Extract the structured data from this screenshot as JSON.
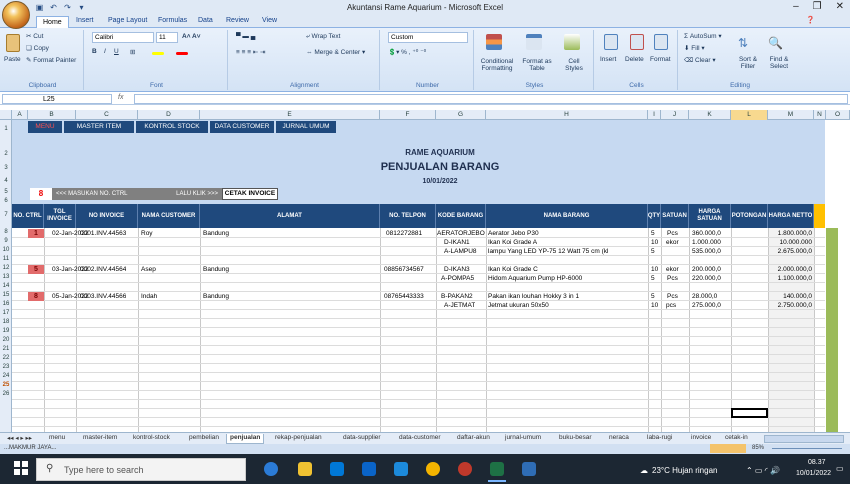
{
  "window": {
    "title": "Akuntansi Rame Aquarium - Microsoft Excel"
  },
  "ribbon_tabs": [
    "Home",
    "Insert",
    "Page Layout",
    "Formulas",
    "Data",
    "Review",
    "View"
  ],
  "ribbon": {
    "clipboard": {
      "paste": "Paste",
      "cut": "Cut",
      "copy": "Copy",
      "format_painter": "Format Painter",
      "label": "Clipboard"
    },
    "font": {
      "name": "Calibri",
      "size": "11",
      "label": "Font"
    },
    "alignment": {
      "wrap": "Wrap Text",
      "merge": "Merge & Center",
      "label": "Alignment"
    },
    "number": {
      "format": "Custom",
      "label": "Number"
    },
    "styles": {
      "conditional": "Conditional Formatting",
      "format_table": "Format as Table",
      "cell_styles": "Cell Styles",
      "label": "Styles"
    },
    "cells": {
      "insert": "Insert",
      "delete": "Delete",
      "format": "Format",
      "label": "Cells"
    },
    "editing": {
      "autosum": "AutoSum",
      "fill": "Fill",
      "clear": "Clear",
      "sort": "Sort & Filter",
      "find": "Find & Select",
      "label": "Editing"
    }
  },
  "formula_bar": {
    "cell_ref": "L25",
    "fx": "fx"
  },
  "columns": [
    "A",
    "B",
    "C",
    "D",
    "E",
    "F",
    "G",
    "H",
    "I",
    "J",
    "K",
    "L",
    "M",
    "N",
    "O"
  ],
  "rows": [
    "1",
    "2",
    "3",
    "4",
    "5",
    "6",
    "7",
    "8",
    "9",
    "10",
    "11",
    "12",
    "13",
    "14",
    "15",
    "16",
    "17",
    "18",
    "19",
    "20",
    "21",
    "22",
    "23",
    "24",
    "25",
    "26"
  ],
  "menu_buttons": [
    "MENU",
    "MASTER ITEM",
    "KONTROL STOCK",
    "DATA CUSTOMER",
    "JURNAL UMUM"
  ],
  "header": {
    "company": "RAME AQUARIUM",
    "title": "PENJUALAN BARANG",
    "date": "10/01/2022"
  },
  "ctrl": {
    "value": "8",
    "prompt": "<<< MASUKAN NO. CTRL",
    "next": "LALU KLIK >>>",
    "button": "CETAK INVOICE"
  },
  "table_headers": [
    "NO. CTRL",
    "TGL INVOICE",
    "NO INVOICE",
    "NAMA CUSTOMER",
    "ALAMAT",
    "NO. TELPON",
    "KODE BARANG",
    "NAMA BARANG",
    "QTY",
    "SATUAN",
    "HARGA SATUAN",
    "POTONGAN",
    "HARGA NETTO"
  ],
  "rows_data": [
    {
      "ctrl": "1",
      "tgl": "02-Jan-2022",
      "inv": "0001.INV.44563",
      "cust": "Roy",
      "alamat": "Bandung",
      "telp": "0812272881",
      "kode": "AERATORJEBO",
      "nama": "Aerator Jebo P30",
      "qty": "5",
      "sat": "Pcs",
      "harga": "360.000,0",
      "netto": "1.800.000,0"
    },
    {
      "ctrl": "",
      "tgl": "",
      "inv": "",
      "cust": "",
      "alamat": "",
      "telp": "",
      "kode": "D-IKAN1",
      "nama": "Ikan Koi Grade A",
      "qty": "10",
      "sat": "ekor",
      "harga": "1.000.000",
      "netto": "10.000.000"
    },
    {
      "ctrl": "",
      "tgl": "",
      "inv": "",
      "cust": "",
      "alamat": "",
      "telp": "",
      "kode": "A-LAMPU8",
      "nama": "lampu Yang LED YP-75 12 Watt 75 cm (kl",
      "qty": "5",
      "sat": "",
      "harga": "535.000,0",
      "netto": "2.675.000,0"
    },
    {
      "ctrl": "",
      "tgl": "",
      "inv": "",
      "cust": "",
      "alamat": "",
      "telp": "",
      "kode": "",
      "nama": "",
      "qty": "",
      "sat": "",
      "harga": "",
      "netto": ""
    },
    {
      "ctrl": "5",
      "tgl": "03-Jan-2022",
      "inv": "0002.INV.44564",
      "cust": "Asep",
      "alamat": "Bandung",
      "telp": "08856734567",
      "kode": "D-IKAN3",
      "nama": "Ikan Koi Grade C",
      "qty": "10",
      "sat": "ekor",
      "harga": "200.000,0",
      "netto": "2.000.000,0"
    },
    {
      "ctrl": "",
      "tgl": "",
      "inv": "",
      "cust": "",
      "alamat": "",
      "telp": "",
      "kode": "A-POMPA5",
      "nama": "Hidom Aquarium Pump HP-6000",
      "qty": "5",
      "sat": "Pcs",
      "harga": "220.000,0",
      "netto": "1.100.000,0"
    },
    {
      "ctrl": "",
      "tgl": "",
      "inv": "",
      "cust": "",
      "alamat": "",
      "telp": "",
      "kode": "",
      "nama": "",
      "qty": "",
      "sat": "",
      "harga": "",
      "netto": ""
    },
    {
      "ctrl": "8",
      "tgl": "05-Jan-2022",
      "inv": "0003.INV.44566",
      "cust": "Indah",
      "alamat": "Bandung",
      "telp": "08765443333",
      "kode": "B-PAKAN2",
      "nama": "Pakan ikan louhan Hokky 3 in 1",
      "qty": "5",
      "sat": "Pcs",
      "harga": "28.000,0",
      "netto": "140.000,0"
    },
    {
      "ctrl": "",
      "tgl": "",
      "inv": "",
      "cust": "",
      "alamat": "",
      "telp": "",
      "kode": "A-JETMAT",
      "nama": "Jetmat ukuran 50x50",
      "qty": "10",
      "sat": "pcs",
      "harga": "275.000,0",
      "netto": "2.750.000,0"
    }
  ],
  "sheet_tabs": [
    "menu",
    "master-item",
    "kontrol-stock",
    "pembelian",
    "penjualan",
    "rekap-penjualan",
    "data-supplier",
    "data-customer",
    "daftar-akun",
    "jurnal-umum",
    "buku-besar",
    "neraca",
    "laba-rugi",
    "invoice",
    "cetak-in"
  ],
  "active_sheet": "penjualan",
  "status": {
    "left": "...MAKMUR JAYA...",
    "zoom": "85%"
  },
  "taskbar": {
    "search": "Type here to search",
    "weather": "23°C  Hujan ringan",
    "time": "08.37",
    "date": "10/01/2022"
  }
}
